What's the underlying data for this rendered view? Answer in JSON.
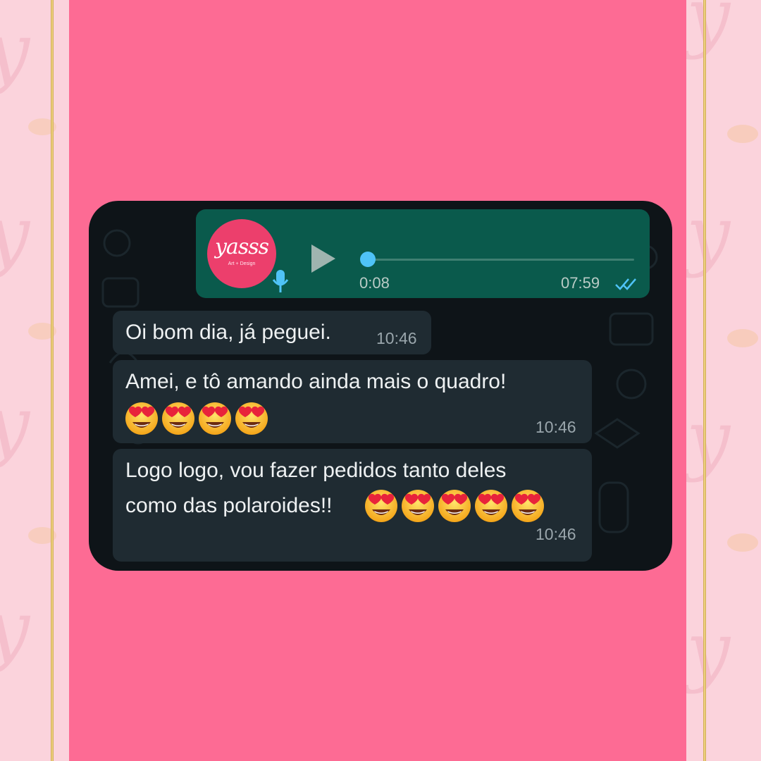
{
  "background": {
    "panel_color": "#fd6b94",
    "frame_color": "#fbd3dc",
    "gold_line_color": "#d9b45a",
    "watermark_glyph": "y"
  },
  "chat": {
    "card_color": "#0e1418",
    "voice_message": {
      "avatar_logo_text": "yasss",
      "avatar_logo_subtext": "Art + Design",
      "play_icon": "play-icon",
      "mic_icon": "microphone-icon",
      "progress": 0.0,
      "duration": "0:08",
      "time": "07:59",
      "status_icon": "double-check-read-icon",
      "bubble_color": "#0a5a4c",
      "accent_color": "#4fc3f7"
    },
    "messages": [
      {
        "text": "Oi bom dia, já peguei.",
        "time": "10:46"
      },
      {
        "text": "Amei, e tô amando ainda mais o quadro!",
        "emoji": "😍",
        "emoji_count": 4,
        "time": "10:46"
      },
      {
        "text": "Logo logo, vou fazer pedidos tanto deles\ncomo das polaroides!!",
        "emoji": "😍",
        "emoji_count": 5,
        "time": "10:46"
      }
    ],
    "incoming_bubble_color": "#1f2b32"
  }
}
